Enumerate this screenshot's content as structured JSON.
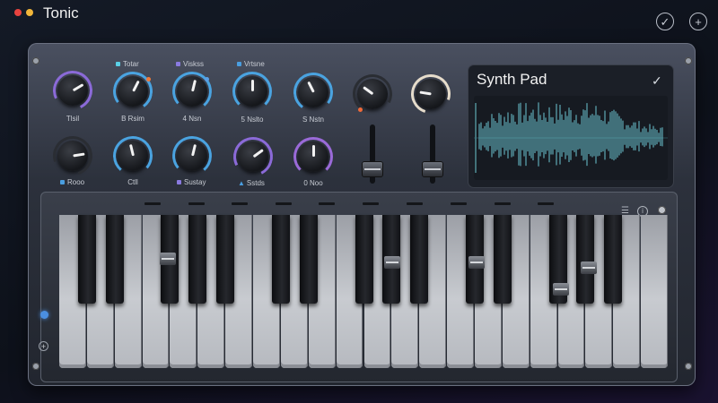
{
  "app": {
    "title": "Tonic"
  },
  "window": {
    "controls": [
      {
        "color": "#e8433f"
      },
      {
        "color": "#f2b63a"
      }
    ]
  },
  "top_buttons": [
    {
      "icon": "checkmark-circle-icon",
      "glyph": "✓"
    },
    {
      "icon": "plus-circle-icon",
      "glyph": "+"
    }
  ],
  "knobs_row1": [
    {
      "label": "Tlsil",
      "ring": "#8b6ad8",
      "value": 0.72
    },
    {
      "label": "B Rsim",
      "ring": "#4aa3e0",
      "value": 0.6,
      "dot": "#f07a3a",
      "top_label": "Totar",
      "top_color": "#5ad0e6"
    },
    {
      "label": "4 Nsn",
      "ring": "#4aa3e0",
      "value": 0.55,
      "dot": "#5aa0e6",
      "top_label": "Viskss",
      "top_color": "#8a7ae0"
    },
    {
      "label": "5 Nslto",
      "ring": "#4aa3e0",
      "value": 0.5,
      "top_label": "Vrtsne",
      "top_color": "#4a9ee0"
    },
    {
      "label": "S Nstn",
      "ring": "#4aa3e0",
      "value": 0.4
    },
    {
      "label": "",
      "ring": "#2a2d33",
      "value": 0.3,
      "dot": "#f06a3a"
    },
    {
      "label": "",
      "ring": "#e6dccb",
      "value": 0.2
    }
  ],
  "knobs_row2": [
    {
      "label": "Rooo",
      "ring": "#2a2d33",
      "value": 0.8,
      "sq": "#4a9ee0"
    },
    {
      "label": "Ctll",
      "ring": "#4aa3e0",
      "value": 0.45
    },
    {
      "label": "Sustay",
      "ring": "#4aa3e0",
      "value": 0.55,
      "sq": "#8a7ae0"
    },
    {
      "label": "Sstds",
      "ring": "#8b6ad8",
      "value": 0.7,
      "tri": "#4a9ee0"
    },
    {
      "label": "0 Noo",
      "ring": "#9a6ad8",
      "value": 0.5
    }
  ],
  "faders": [
    {
      "level": 0.25
    },
    {
      "level": 0.25
    }
  ],
  "display": {
    "title": "Synth Pad",
    "check": "✓"
  },
  "keyboard": {
    "white_keys": 22,
    "side_add": "+"
  }
}
